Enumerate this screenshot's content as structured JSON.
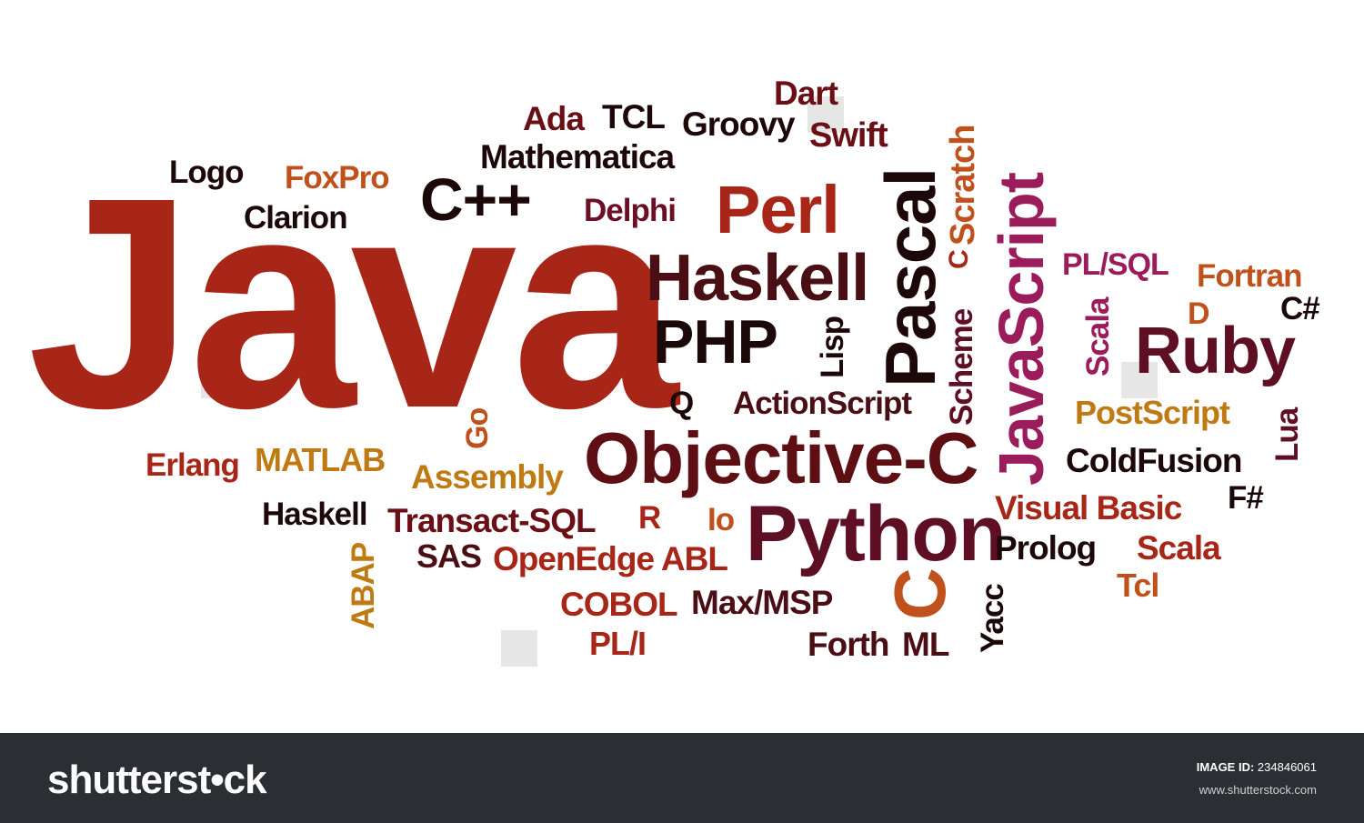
{
  "words": [
    {
      "id": "java",
      "text": "Java",
      "color": "#a82618"
    },
    {
      "id": "perl",
      "text": "Perl",
      "color": "#a82618"
    },
    {
      "id": "haskell-big",
      "text": "Haskell",
      "color": "#4a0f14"
    },
    {
      "id": "php",
      "text": "PHP",
      "color": "#1c0808"
    },
    {
      "id": "pascal",
      "text": "Pascal",
      "color": "#1c0808"
    },
    {
      "id": "javascript",
      "text": "JavaScript",
      "color": "#9a1c5a"
    },
    {
      "id": "objective-c",
      "text": "Objective-C",
      "color": "#5e0f14"
    },
    {
      "id": "python",
      "text": "Python",
      "color": "#5e0f24"
    },
    {
      "id": "ruby",
      "text": "Ruby",
      "color": "#5e0f24"
    },
    {
      "id": "c-plus-plus",
      "text": "C++",
      "color": "#1c0808"
    },
    {
      "id": "c-big",
      "text": "C",
      "color": "#c0501c"
    },
    {
      "id": "c-small",
      "text": "C",
      "color": "#a82618"
    },
    {
      "id": "dart",
      "text": "Dart",
      "color": "#6b0f16"
    },
    {
      "id": "ada",
      "text": "Ada",
      "color": "#6b0f16"
    },
    {
      "id": "tcl-upper",
      "text": "TCL",
      "color": "#1c0808"
    },
    {
      "id": "groovy",
      "text": "Groovy",
      "color": "#1c0808"
    },
    {
      "id": "swift",
      "text": "Swift",
      "color": "#6b0f16"
    },
    {
      "id": "scratch",
      "text": "Scratch",
      "color": "#c0501c"
    },
    {
      "id": "mathematica",
      "text": "Mathematica",
      "color": "#1c0808"
    },
    {
      "id": "logo",
      "text": "Logo",
      "color": "#1c0808"
    },
    {
      "id": "foxpro",
      "text": "FoxPro",
      "color": "#c0501c"
    },
    {
      "id": "clarion",
      "text": "Clarion",
      "color": "#1c0808"
    },
    {
      "id": "delphi",
      "text": "Delphi",
      "color": "#6b0f24"
    },
    {
      "id": "pl-sql",
      "text": "PL/SQL",
      "color": "#9a1c5a"
    },
    {
      "id": "fortran",
      "text": "Fortran",
      "color": "#c0501c"
    },
    {
      "id": "d",
      "text": "D",
      "color": "#c0501c"
    },
    {
      "id": "c-sharp",
      "text": "C#",
      "color": "#1c0808"
    },
    {
      "id": "scala-vertical",
      "text": "Scala",
      "color": "#9a1c5a"
    },
    {
      "id": "lisp",
      "text": "Lisp",
      "color": "#1c0808"
    },
    {
      "id": "scheme",
      "text": "Scheme",
      "color": "#5e0f24"
    },
    {
      "id": "q",
      "text": "Q",
      "color": "#1c0808"
    },
    {
      "id": "actionscript",
      "text": "ActionScript",
      "color": "#4a0f14"
    },
    {
      "id": "postscript",
      "text": "PostScript",
      "color": "#c07a14"
    },
    {
      "id": "lua",
      "text": "Lua",
      "color": "#5e0f24"
    },
    {
      "id": "go",
      "text": "Go",
      "color": "#c0501c"
    },
    {
      "id": "erlang",
      "text": "Erlang",
      "color": "#a82618"
    },
    {
      "id": "matlab",
      "text": "MATLAB",
      "color": "#c07a14"
    },
    {
      "id": "assembly",
      "text": "Assembly",
      "color": "#c07a14"
    },
    {
      "id": "coldfusion",
      "text": "ColdFusion",
      "color": "#1c0808"
    },
    {
      "id": "visual-basic",
      "text": "Visual Basic",
      "color": "#a82618"
    },
    {
      "id": "f-sharp",
      "text": "F#",
      "color": "#1c0808"
    },
    {
      "id": "haskell-small",
      "text": "Haskell",
      "color": "#1c0808"
    },
    {
      "id": "transact-sql",
      "text": "Transact-SQL",
      "color": "#6b0f16"
    },
    {
      "id": "r",
      "text": "R",
      "color": "#a82618"
    },
    {
      "id": "io",
      "text": "Io",
      "color": "#c0501c"
    },
    {
      "id": "prolog",
      "text": "Prolog",
      "color": "#1c0808"
    },
    {
      "id": "scala",
      "text": "Scala",
      "color": "#a82618"
    },
    {
      "id": "abap",
      "text": "ABAP",
      "color": "#c07a14"
    },
    {
      "id": "sas",
      "text": "SAS",
      "color": "#4a0f14"
    },
    {
      "id": "openedge-abl",
      "text": "OpenEdge ABL",
      "color": "#a82618"
    },
    {
      "id": "tcl",
      "text": "Tcl",
      "color": "#c0501c"
    },
    {
      "id": "cobol",
      "text": "COBOL",
      "color": "#a82618"
    },
    {
      "id": "max-msp",
      "text": "Max/MSP",
      "color": "#4a0f14"
    },
    {
      "id": "yacc",
      "text": "Yacc",
      "color": "#1c0808"
    },
    {
      "id": "pl-i",
      "text": "PL/I",
      "color": "#a82618"
    },
    {
      "id": "forth",
      "text": "Forth",
      "color": "#4a0f14"
    },
    {
      "id": "ml",
      "text": "ML",
      "color": "#4a0f14"
    }
  ],
  "footer": {
    "brand": "shutterst•ck",
    "image_id_label": "IMAGE ID:",
    "image_id": "234846061",
    "site": "www.shutterstock.com"
  }
}
